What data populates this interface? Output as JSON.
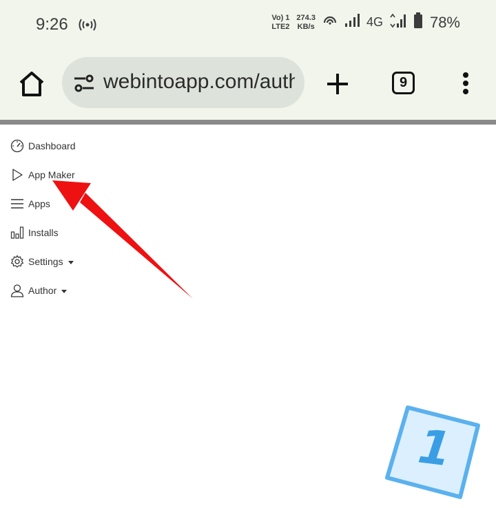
{
  "status_bar": {
    "time": "9:26",
    "volte_line1": "Vo) 1",
    "volte_line2": "LTE2",
    "speed_value": "274.3",
    "speed_unit": "KB/s",
    "network_type": "4G",
    "battery_percent": "78%"
  },
  "browser": {
    "url": "webintoapp.com/author",
    "tab_count": "9"
  },
  "nav": {
    "items": [
      {
        "label": "Dashboard"
      },
      {
        "label": "App Maker"
      },
      {
        "label": "Apps"
      },
      {
        "label": "Installs"
      },
      {
        "label": "Settings"
      },
      {
        "label": "Author"
      }
    ]
  },
  "annotation": {
    "step_number": "1",
    "arrow_color": "#ee1111",
    "badge_color": "#5bb1ee"
  }
}
